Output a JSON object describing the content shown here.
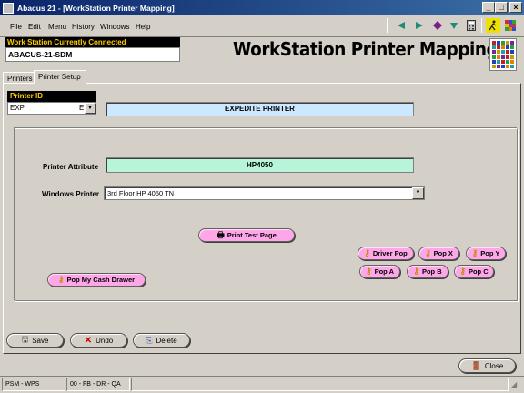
{
  "window": {
    "title": "Abacus 21 - [WorkStation Printer Mapping]",
    "minimize_glyph": "_",
    "maximize_glyph": "□",
    "close_glyph": "×"
  },
  "menu": {
    "items": [
      "File",
      "Edit",
      "Menu",
      "History",
      "Windows",
      "Help"
    ]
  },
  "toolbar": {
    "icons": [
      "prev-arrow-icon",
      "next-arrow-icon",
      "purple-gem-icon",
      "down-arrow-icon",
      "calculator-icon",
      "runner-icon",
      "grid-icon"
    ]
  },
  "workstation": {
    "label": "Work Station Currently Connected",
    "value": "ABACUS-21-SDM"
  },
  "heading": "WorkStation Printer Mapping",
  "tabs": [
    {
      "label": "Printers",
      "active": false
    },
    {
      "label": "Printer Setup",
      "active": true
    }
  ],
  "printer_id": {
    "label": "Printer ID",
    "value": "EXP",
    "suffix": "E",
    "name": "EXPEDITE PRINTER"
  },
  "printer_attribute": {
    "label": "Printer Attribute",
    "value": "HP4050"
  },
  "windows_printer": {
    "label": "Windows Printer",
    "value": "3rd Floor HP 4050 TN"
  },
  "buttons": {
    "print_test_page": "Print Test Page",
    "driver_pop": "Driver Pop",
    "pop_x": "Pop X",
    "pop_y": "Pop Y",
    "pop_a": "Pop A",
    "pop_b": "Pop B",
    "pop_c": "Pop C",
    "pop_cash_drawer": "Pop My Cash Drawer",
    "save": "Save",
    "undo": "Undo",
    "delete": "Delete",
    "close": "Close"
  },
  "status": {
    "left": "PSM - WPS",
    "middle": "00 - FB - DR - QA"
  },
  "colors": {
    "title_bar": "#0a246a",
    "pill_button": "#ffa6e8",
    "printer_name_bg": "#cce8ff",
    "attribute_bg": "#b8f5d8",
    "label_bg": "#000000",
    "label_text": "#ffcc00"
  }
}
